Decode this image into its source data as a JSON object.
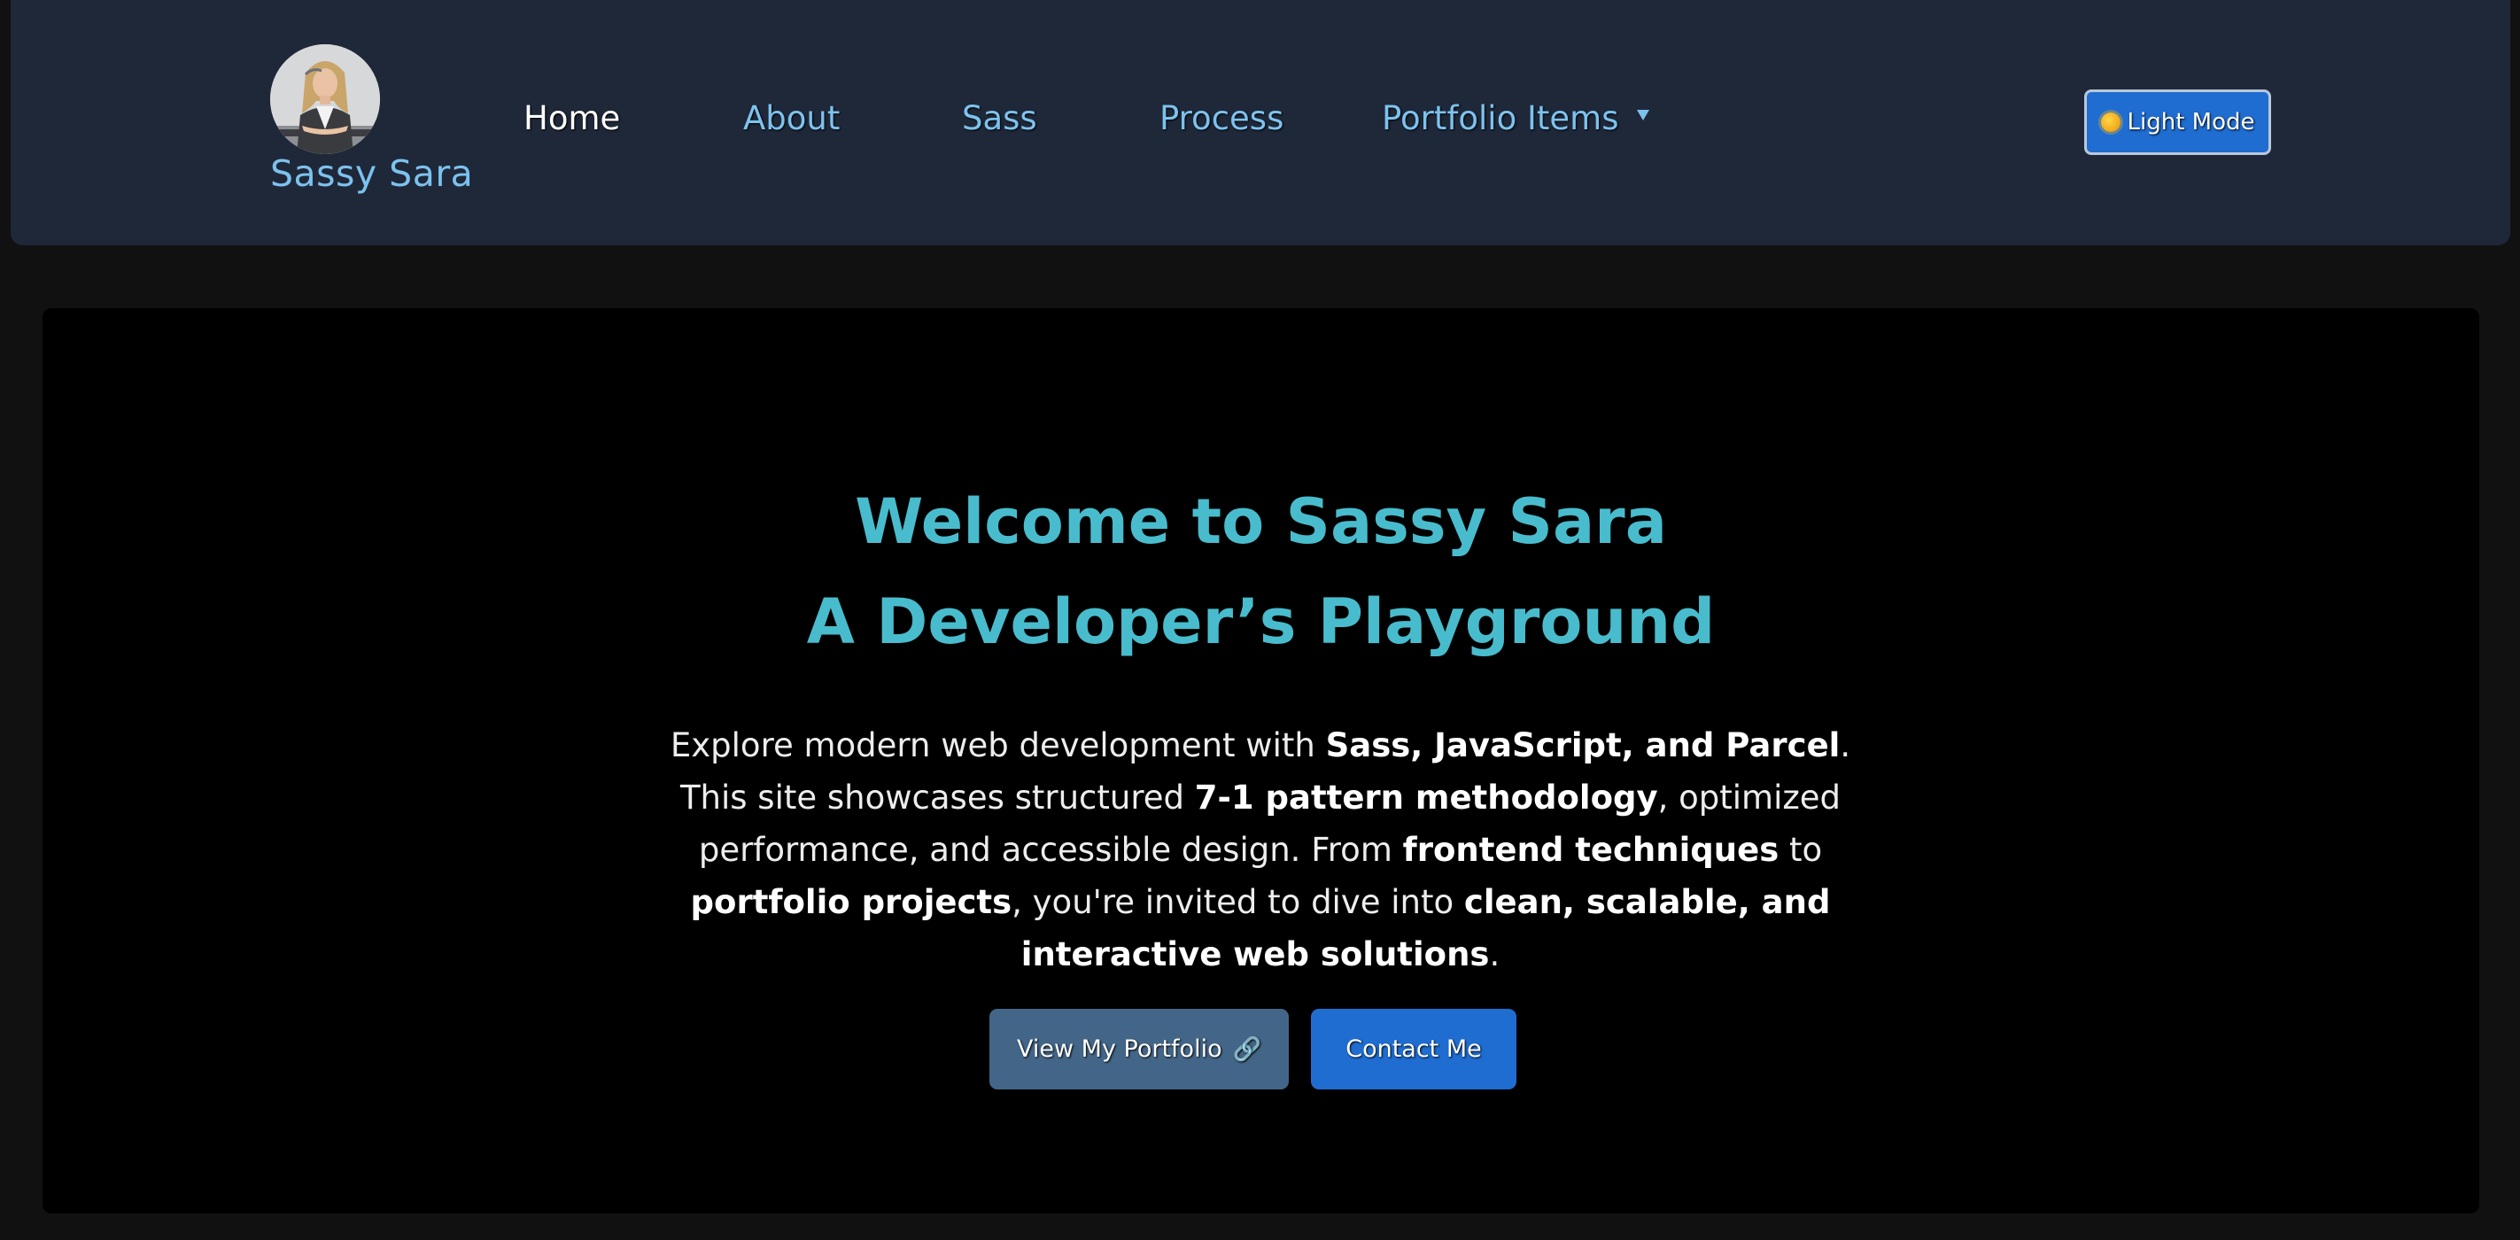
{
  "header": {
    "brand_name": "Sassy Sara",
    "avatar_icon": "profile-photo",
    "nav": [
      {
        "label": "Home",
        "active": true
      },
      {
        "label": "About",
        "active": false
      },
      {
        "label": "Sass",
        "active": false
      },
      {
        "label": "Process",
        "active": false
      },
      {
        "label": "Portfolio Items",
        "active": false,
        "has_dropdown": true
      }
    ],
    "mode_toggle": {
      "label": "Light Mode",
      "icon": "sun-icon"
    }
  },
  "hero": {
    "title_line1": "Welcome to Sassy Sara",
    "title_line2": "A Developer’s Playground",
    "intro": {
      "p1": "Explore modern web development with ",
      "b1": "Sass, JavaScript, and Parcel",
      "p2": ". This site showcases structured ",
      "b2": "7-1 pattern methodology",
      "p3": ", optimized performance, and accessible design. From ",
      "b3": "frontend techniques",
      "p4": " to ",
      "b4": "portfolio projects",
      "p5": ", you're invited to dive into ",
      "b5": "clean, scalable, and interactive web solutions",
      "p6": "."
    },
    "buttons": {
      "portfolio": "View My Portfolio",
      "portfolio_icon": "🔗",
      "contact": "Contact Me"
    }
  },
  "colors": {
    "page_bg": "#111111",
    "navbar_bg": "#1f2839",
    "hero_bg": "#000000",
    "link": "#7dc2ee",
    "title": "#48bccd",
    "primary_button": "#1f6dd1",
    "secondary_button": "#436688"
  }
}
